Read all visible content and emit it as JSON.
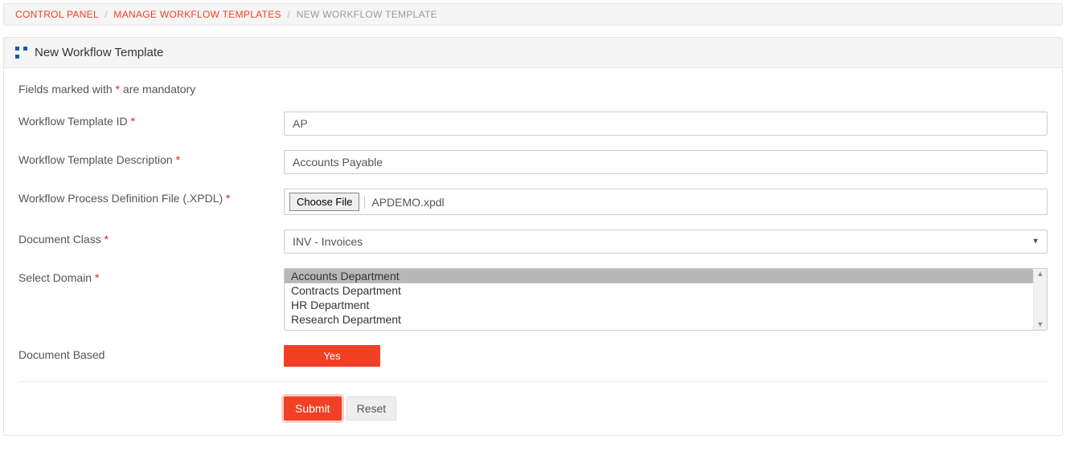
{
  "breadcrumb": {
    "items": [
      "CONTROL PANEL",
      "MANAGE WORKFLOW TEMPLATES"
    ],
    "current": "NEW WORKFLOW TEMPLATE"
  },
  "panel": {
    "title": "New Workflow Template"
  },
  "mandatory": {
    "prefix": "Fields marked with ",
    "star": "*",
    "suffix": " are mandatory"
  },
  "fields": {
    "template_id": {
      "label": "Workflow Template ID ",
      "value": "AP"
    },
    "template_desc": {
      "label": "Workflow Template Description ",
      "value": "Accounts Payable"
    },
    "xpdl": {
      "label": "Workflow Process Definition File (.XPDL) ",
      "choose": "Choose File",
      "filename": "APDEMO.xpdl"
    },
    "doc_class": {
      "label": "Document Class ",
      "value": "INV - Invoices"
    },
    "domain": {
      "label": "Select Domain ",
      "options": [
        "Accounts Department",
        "Contracts Department",
        "HR Department",
        "Research Department"
      ],
      "selected_index": 0
    },
    "doc_based": {
      "label": "Document Based",
      "value": "Yes"
    }
  },
  "buttons": {
    "submit": "Submit",
    "reset": "Reset"
  },
  "required_mark": "*"
}
